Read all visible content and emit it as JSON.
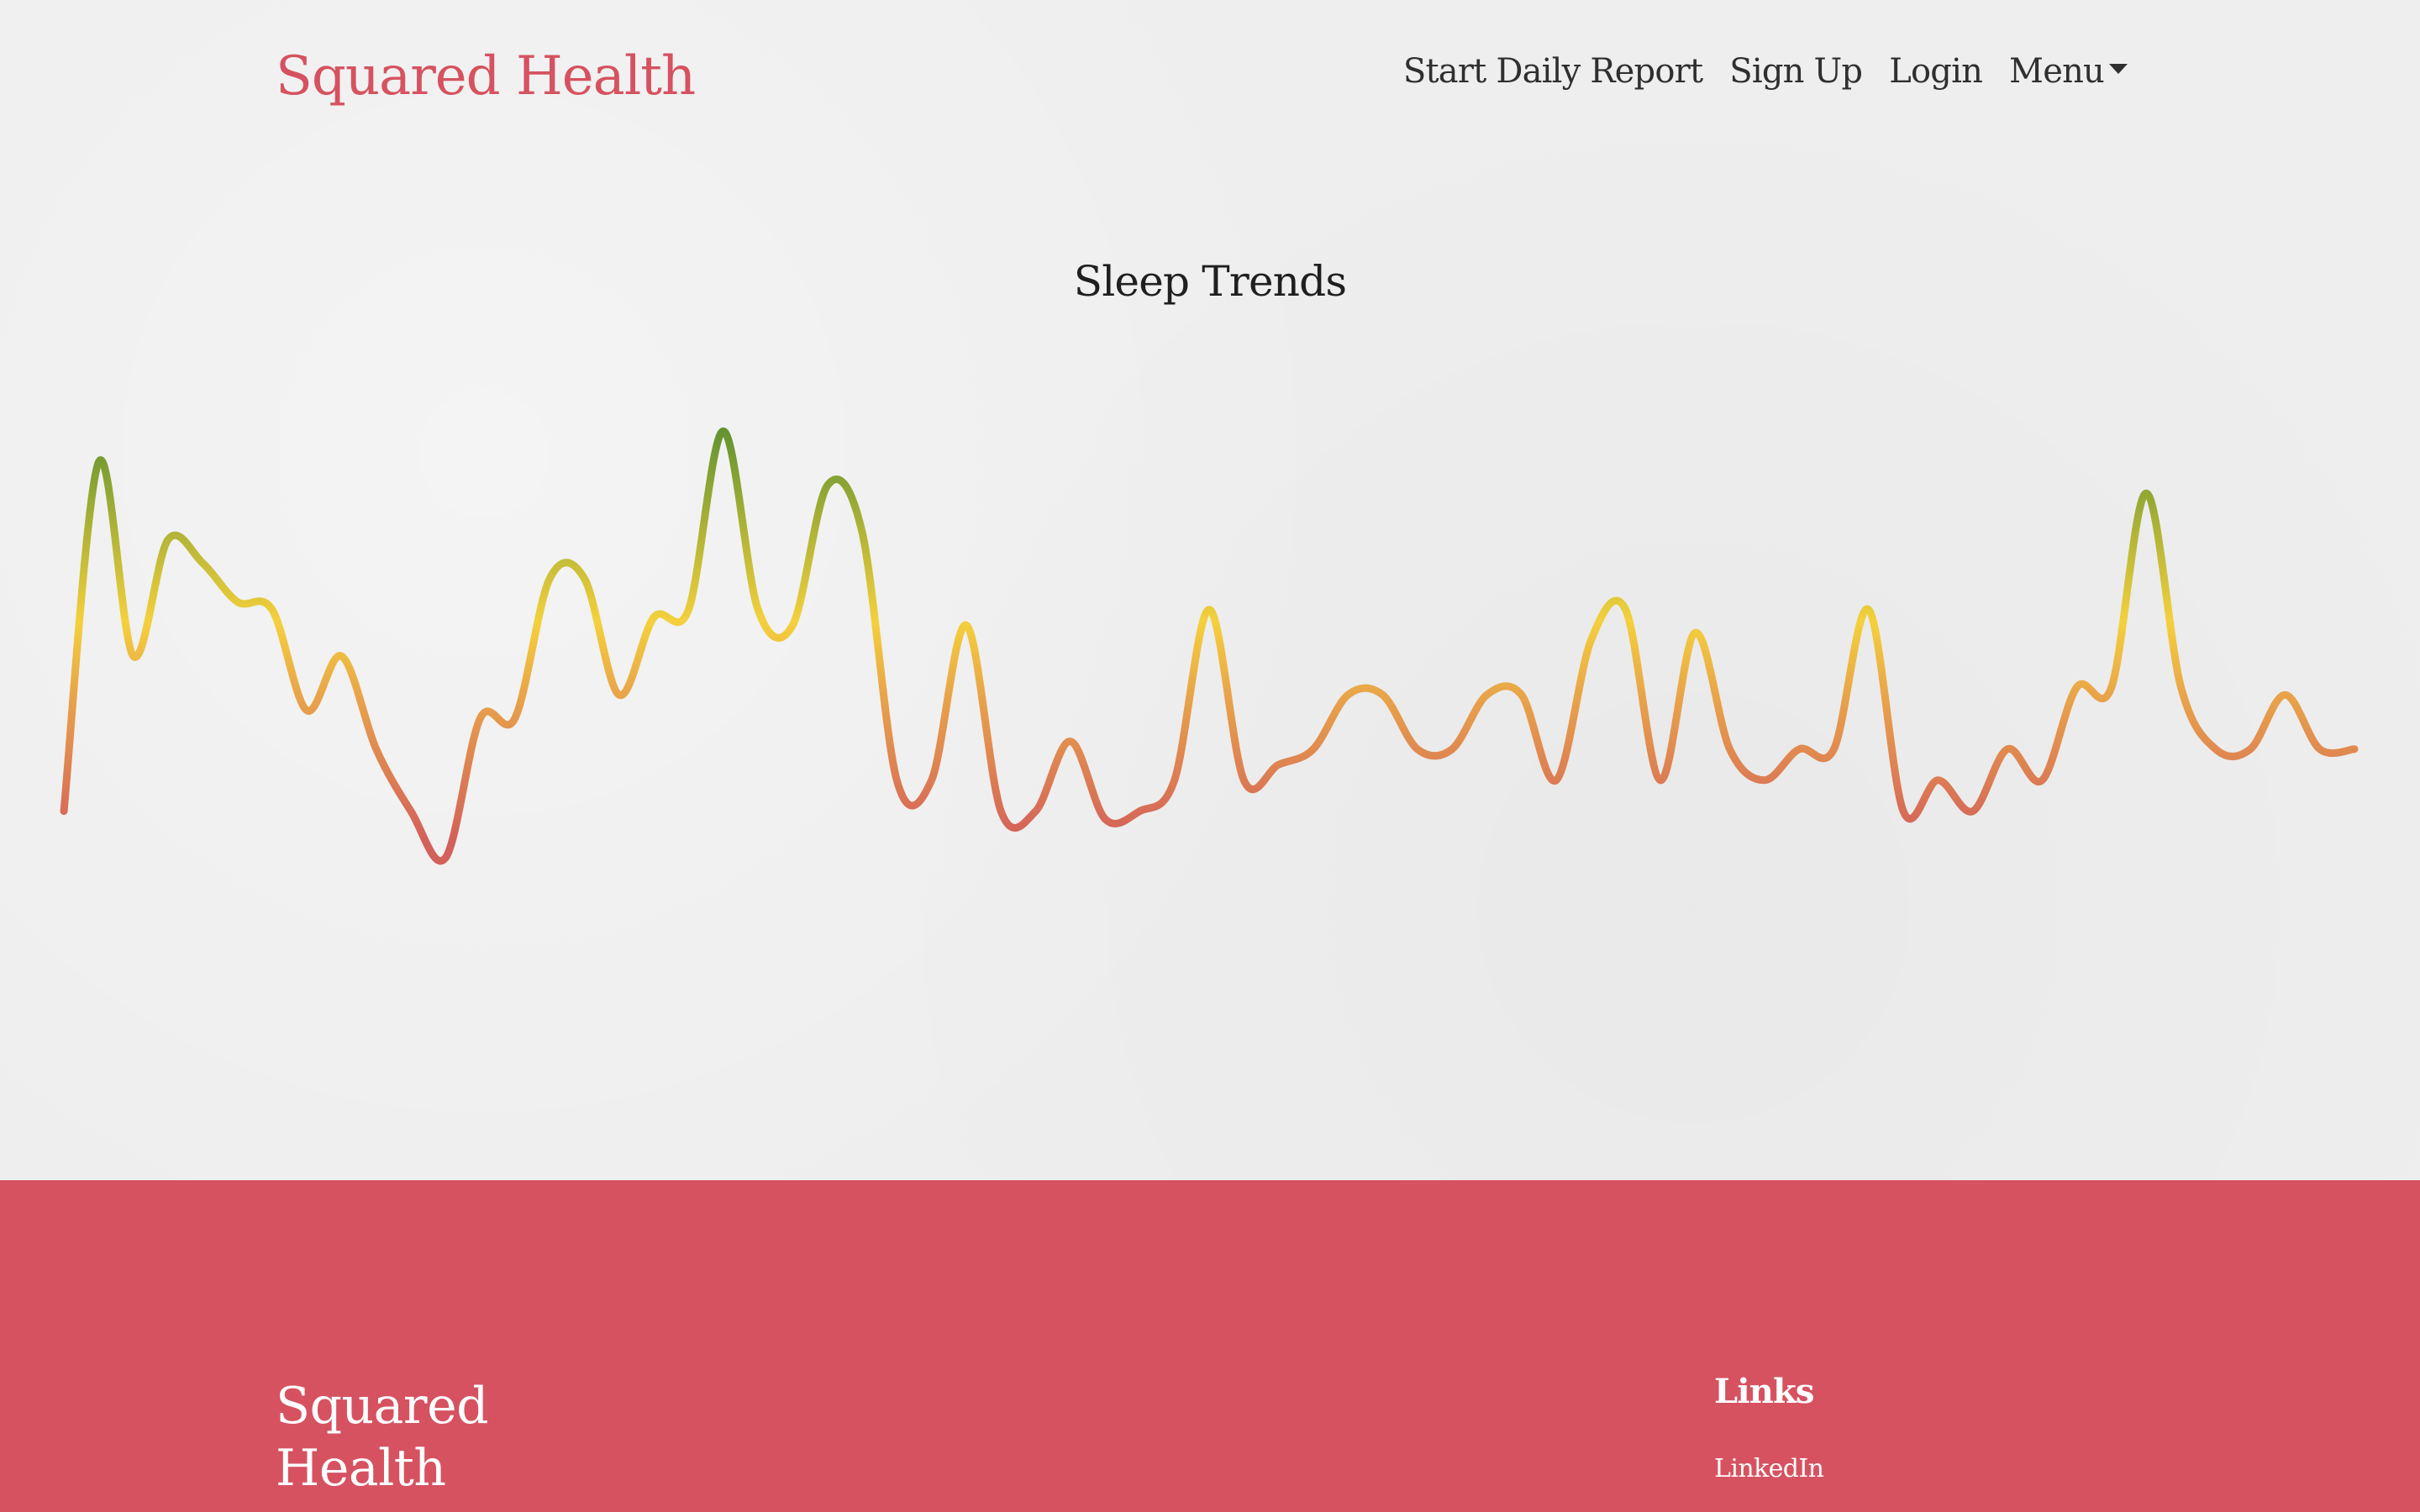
{
  "header": {
    "brand": "Squared Health",
    "nav": [
      {
        "label": "Start Daily Report"
      },
      {
        "label": "Sign Up"
      },
      {
        "label": "Login"
      },
      {
        "label": "Menu"
      }
    ]
  },
  "main": {
    "title": "Sleep Trends"
  },
  "colors": {
    "brand": "#d65260",
    "trend_high": "#5a9030",
    "trend_mid": "#f4d03c",
    "trend_low": "#d3605a"
  },
  "footer": {
    "brand": "Squared Health",
    "links_heading": "Links",
    "links": [
      {
        "label": "LinkedIn"
      }
    ]
  },
  "chart_data": {
    "type": "line",
    "title": "Sleep Trends",
    "xlabel": "",
    "ylabel": "",
    "grid": false,
    "y": [
      4.0,
      8.5,
      6.0,
      7.5,
      7.2,
      6.7,
      6.6,
      5.3,
      6.0,
      4.8,
      4.0,
      3.4,
      5.2,
      5.2,
      7.0,
      7.0,
      5.5,
      6.5,
      6.6,
      8.9,
      6.6,
      6.4,
      8.2,
      7.6,
      4.4,
      4.4,
      6.4,
      4.0,
      4.0,
      4.9,
      3.9,
      4.0,
      4.4,
      6.6,
      4.4,
      4.6,
      4.8,
      5.5,
      5.5,
      4.8,
      4.8,
      5.5,
      5.5,
      4.4,
      6.2,
      6.6,
      4.4,
      6.3,
      4.8,
      4.4,
      4.8,
      4.8,
      6.6,
      4.0,
      4.4,
      4.0,
      4.8,
      4.4,
      5.6,
      5.6,
      8.1,
      5.6,
      4.8,
      4.8,
      5.5,
      4.8,
      4.8
    ],
    "ylim": [
      3.0,
      9.5
    ]
  }
}
